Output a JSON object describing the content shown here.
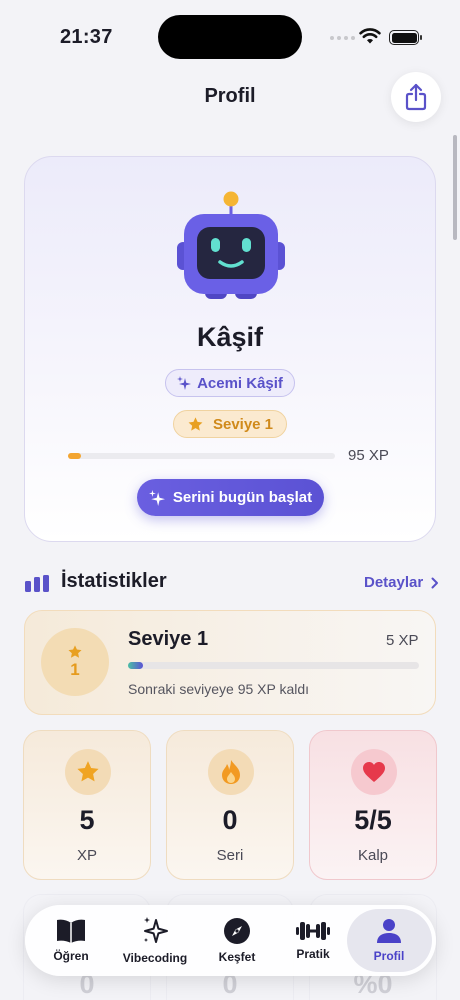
{
  "status_bar": {
    "time": "21:37"
  },
  "header": {
    "title": "Profil"
  },
  "profile": {
    "name": "Kâşif",
    "rank": "Acemi Kâşif",
    "level": "Seviye 1",
    "xp_label": "95 XP",
    "xp_progress": 0.05,
    "cta_label": "Serini bugün başlat"
  },
  "stats": {
    "title": "İstatistikler",
    "details_label": "Detaylar",
    "level_card": {
      "level_number": "1",
      "title": "Seviye 1",
      "xp": "5 XP",
      "progress": 0.05,
      "remaining": "Sonraki seviyeye 95 XP kaldı"
    },
    "tiles": [
      {
        "value": "5",
        "label": "XP",
        "icon": "star-icon"
      },
      {
        "value": "0",
        "label": "Seri",
        "icon": "flame-icon"
      },
      {
        "value": "5/5",
        "label": "Kalp",
        "icon": "heart-icon"
      }
    ],
    "tiles_row2": [
      {
        "value": "0"
      },
      {
        "value": "0"
      },
      {
        "value": "%0"
      }
    ]
  },
  "tab_bar": {
    "items": [
      {
        "label": "Öğren",
        "icon": "book-icon"
      },
      {
        "label": "Vibecoding",
        "icon": "sparkles-icon"
      },
      {
        "label": "Keşfet",
        "icon": "compass-icon"
      },
      {
        "label": "Pratik",
        "icon": "dumbbell-icon"
      },
      {
        "label": "Profil",
        "icon": "person-icon"
      }
    ],
    "active": "Profil"
  },
  "colors": {
    "accent": "#5a52c9",
    "orange": "#f3a531",
    "heart": "#e6394b"
  }
}
